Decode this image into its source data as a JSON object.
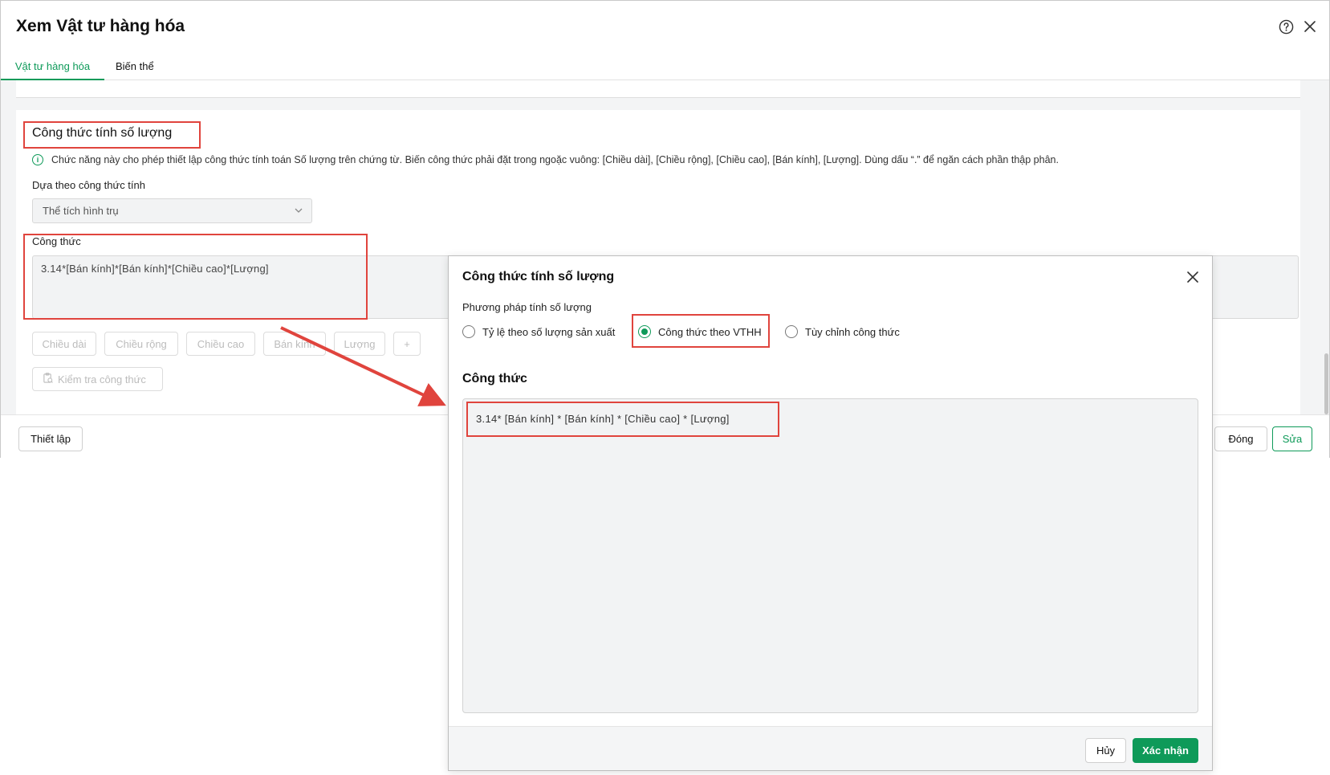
{
  "window": {
    "title": "Xem Vật tư hàng hóa",
    "tabs": [
      "Vật tư hàng hóa",
      "Biến thể"
    ],
    "active_tab": "Vật tư hàng hóa"
  },
  "section": {
    "title": "Công thức tính số lượng",
    "info_text": "Chức năng này cho phép thiết lập công thức tính toán Số lượng trên chứng từ. Biến công thức phải đặt trong ngoặc vuông: [Chiều dài], [Chiều rộng], [Chiều cao], [Bán kính], [Lượng]. Dùng dấu “.” để ngăn cách phần thập phân.",
    "based_on_label": "Dựa theo công thức tính",
    "based_on_value": "Thể tích hình trụ",
    "formula_label": "Công thức",
    "formula_value": "3.14*[Bán kính]*[Bán kính]*[Chiều cao]*[Lượng]",
    "chips": [
      "Chiều dài",
      "Chiều rộng",
      "Chiều cao",
      "Bán kính",
      "Lượng",
      "+"
    ],
    "check_formula_label": "Kiểm tra công thức"
  },
  "footer": {
    "setup_label": "Thiết lập",
    "close_label": "Đóng",
    "edit_label": "Sửa"
  },
  "dialog": {
    "title": "Công thức tính số lượng",
    "method_label": "Phương pháp tính số lượng",
    "options": [
      {
        "label": "Tỷ lệ theo số lượng sản xuất",
        "checked": false
      },
      {
        "label": "Công thức theo VTHH",
        "checked": true
      },
      {
        "label": "Tùy chỉnh công thức",
        "checked": false
      }
    ],
    "formula_label": "Công thức",
    "formula_value": "3.14* [Bán kính] * [Bán kính] * [Chiều cao] * [Lượng]",
    "cancel_label": "Hủy",
    "confirm_label": "Xác nhận"
  },
  "colors": {
    "accent": "#0e9a59",
    "annotation": "#e0443d",
    "side_tab": "#1e88e5"
  },
  "icons": [
    "help-icon",
    "close-icon",
    "info-icon",
    "chevron-down-icon",
    "clipboard-check-icon",
    "chevron-left-icon"
  ]
}
